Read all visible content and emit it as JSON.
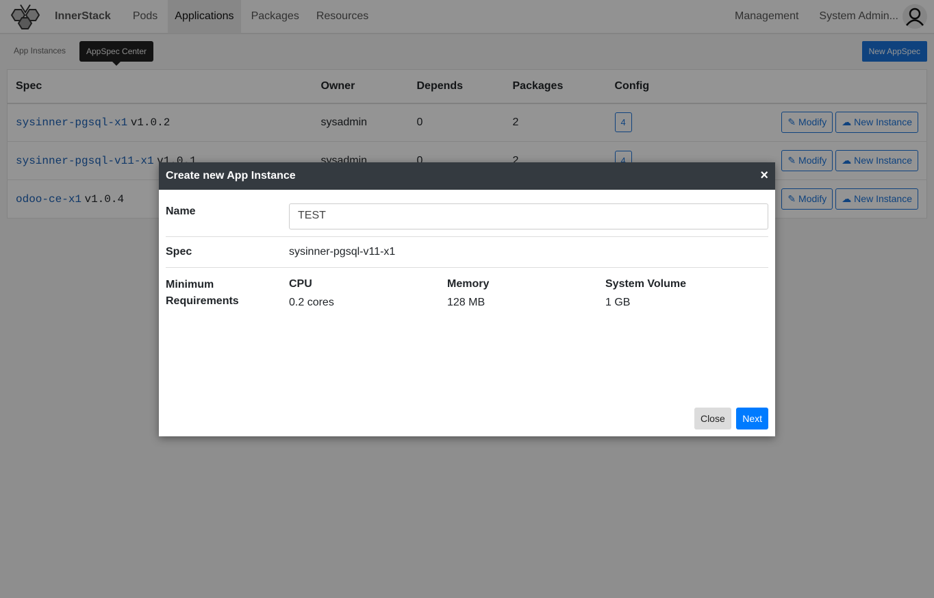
{
  "nav": {
    "brand": "InnerStack",
    "items": [
      "Pods",
      "Applications",
      "Packages",
      "Resources"
    ],
    "active": "Applications",
    "management": "Management",
    "user": "System Admin..."
  },
  "subnav": {
    "app_instances": "App Instances",
    "appspec_center": "AppSpec Center",
    "new_appspec": "New AppSpec"
  },
  "table": {
    "headers": [
      "Spec",
      "Owner",
      "Depends",
      "Packages",
      "Config"
    ],
    "rows": [
      {
        "spec": "sysinner-pgsql-x1",
        "version": "v1.0.2",
        "owner": "sysadmin",
        "depends": "0",
        "packages": "2",
        "config": "4"
      },
      {
        "spec": "sysinner-pgsql-v11-x1",
        "version": "v1.0.1",
        "owner": "sysadmin",
        "depends": "0",
        "packages": "2",
        "config": "4"
      },
      {
        "spec": "odoo-ce-x1",
        "version": "v1.0.4",
        "owner": "",
        "depends": "",
        "packages": "",
        "config": ""
      }
    ],
    "modify": "Modify",
    "new_instance": "New Instance"
  },
  "modal": {
    "title": "Create new App Instance",
    "close_icon": "×",
    "name_label": "Name",
    "name_value": "TEST",
    "spec_label": "Spec",
    "spec_value": "sysinner-pgsql-v11-x1",
    "req_label": "Minimum Requirements",
    "cpu_label": "CPU",
    "cpu_value": "0.2 cores",
    "mem_label": "Memory",
    "mem_value": "128 MB",
    "vol_label": "System Volume",
    "vol_value": "1 GB",
    "close": "Close",
    "next": "Next"
  },
  "colors": {
    "primary": "#007bff",
    "header": "#343a40"
  }
}
